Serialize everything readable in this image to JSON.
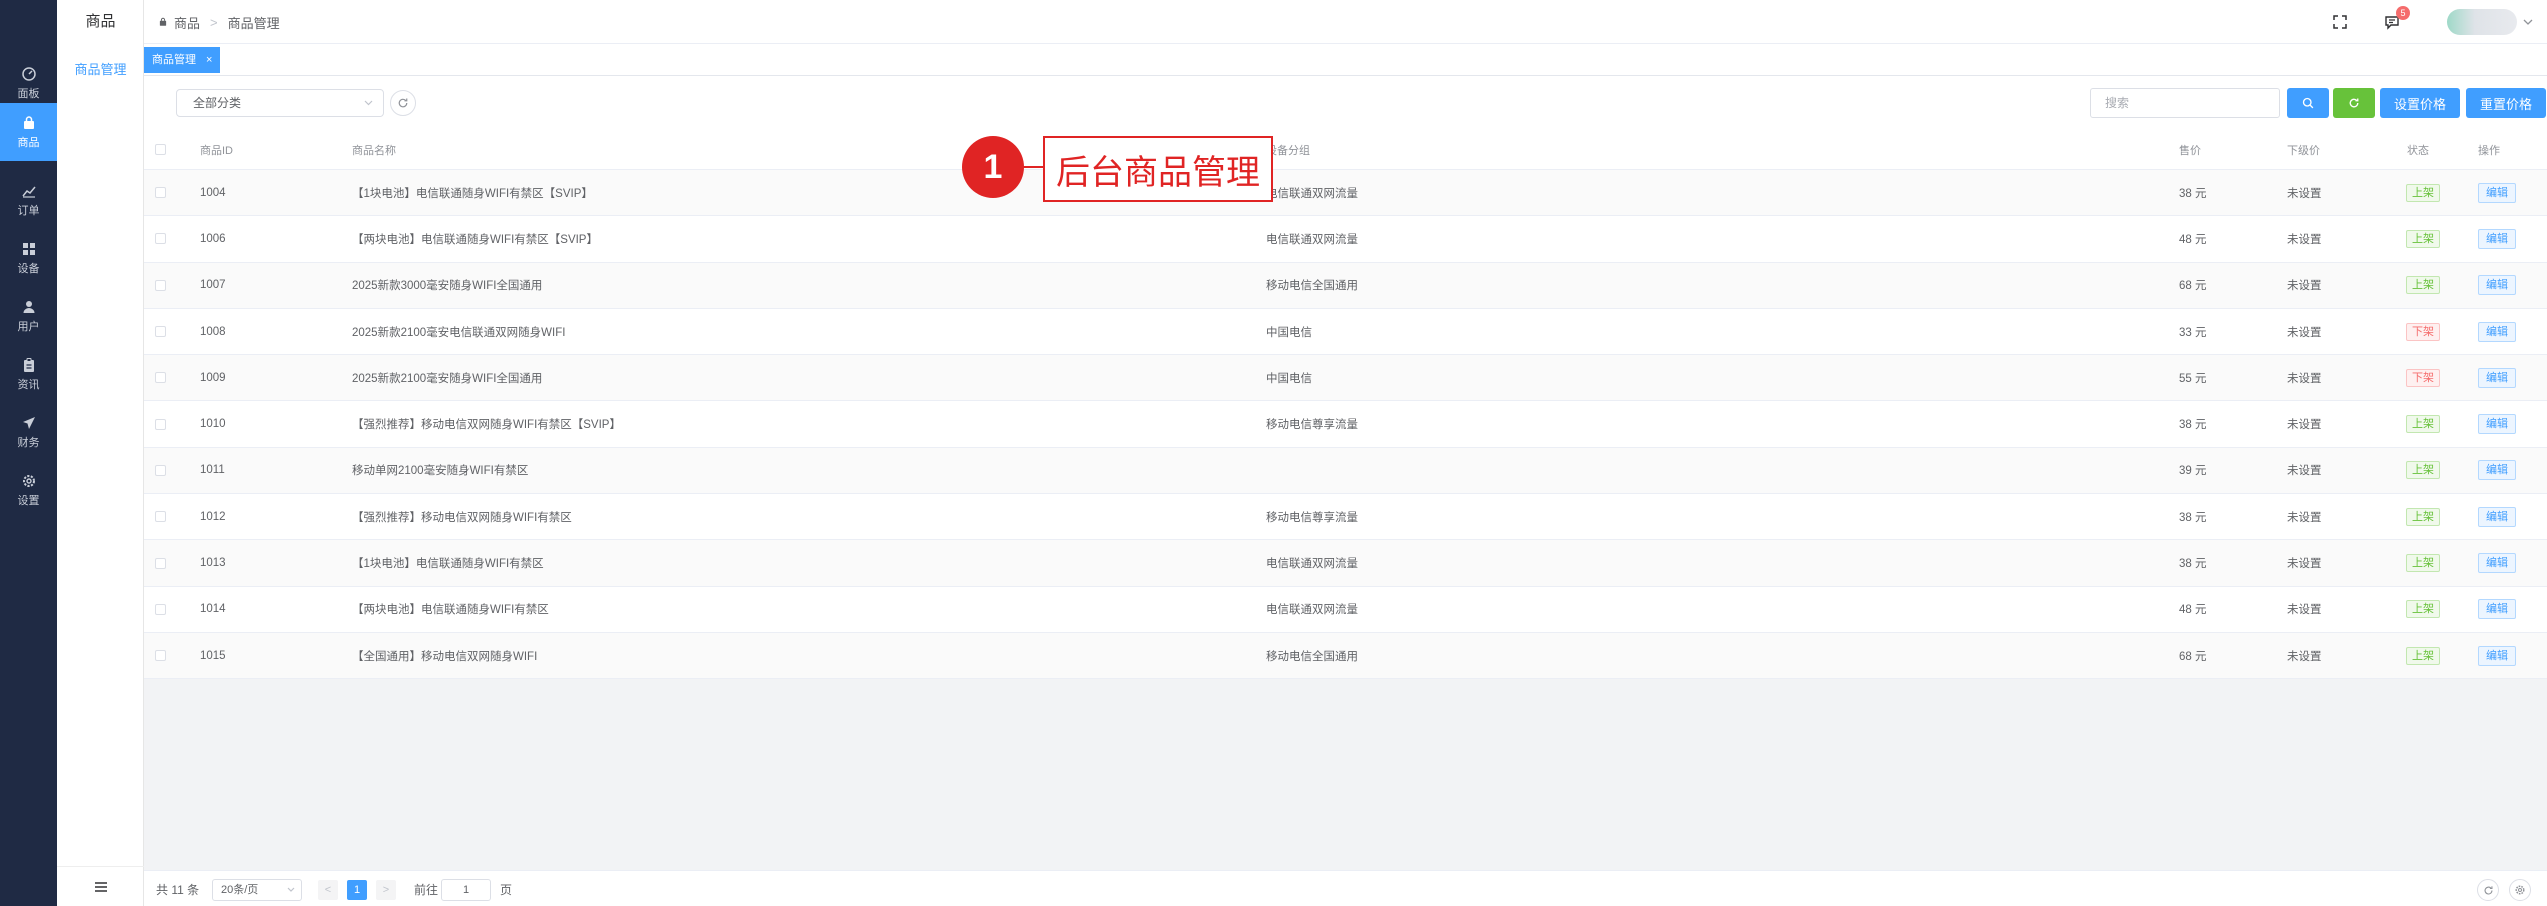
{
  "rail": [
    {
      "label": "面板",
      "icon": "gauge-icon"
    },
    {
      "label": "商品",
      "icon": "shopping-bag-icon",
      "active": true
    },
    {
      "label": "订单",
      "icon": "order-chart-icon"
    },
    {
      "label": "设备",
      "icon": "grid-icon"
    },
    {
      "label": "用户",
      "icon": "user-icon"
    },
    {
      "label": "资讯",
      "icon": "clipboard-icon"
    },
    {
      "label": "财务",
      "icon": "paper-plane-icon"
    },
    {
      "label": "设置",
      "icon": "gear-icon"
    }
  ],
  "submenu": {
    "title": "商品",
    "item": "商品管理",
    "bottom_icon": "hamburger-icon"
  },
  "breadcrumb": {
    "first": "商品",
    "separator": ">",
    "second": "商品管理"
  },
  "header": {
    "notifications": "5",
    "icons": [
      "fullscreen-icon",
      "message-icon",
      "avatar"
    ]
  },
  "tabs": [
    {
      "label": "商品管理",
      "close": "×"
    }
  ],
  "toolbar": {
    "category_select": "全部分类",
    "search_placeholder": "搜索",
    "set_price_label": "设置价格",
    "reset_price_label": "重置价格"
  },
  "annotation": {
    "number": "1",
    "text": "后台商品管理"
  },
  "table": {
    "headers": {
      "id": "商品ID",
      "name": "商品名称",
      "group": "设备分组",
      "price": "售价",
      "lower": "下级价",
      "status": "状态",
      "action": "操作"
    },
    "rows": [
      {
        "id": "1004",
        "name": "【1块电池】电信联通随身WIFI有禁区【SVIP】",
        "group": "电信联通双网流量",
        "price": "38 元",
        "lower": "未设置",
        "status": "上架",
        "on": true,
        "action": "编辑"
      },
      {
        "id": "1006",
        "name": "【两块电池】电信联通随身WIFI有禁区【SVIP】",
        "group": "电信联通双网流量",
        "price": "48 元",
        "lower": "未设置",
        "status": "上架",
        "on": true,
        "action": "编辑"
      },
      {
        "id": "1007",
        "name": "2025新款3000毫安随身WIFI全国通用",
        "group": "移动电信全国通用",
        "price": "68 元",
        "lower": "未设置",
        "status": "上架",
        "on": true,
        "action": "编辑"
      },
      {
        "id": "1008",
        "name": "2025新款2100毫安电信联通双网随身WIFI",
        "group": "中国电信",
        "price": "33 元",
        "lower": "未设置",
        "status": "下架",
        "on": false,
        "action": "编辑"
      },
      {
        "id": "1009",
        "name": "2025新款2100毫安随身WIFI全国通用",
        "group": "中国电信",
        "price": "55 元",
        "lower": "未设置",
        "status": "下架",
        "on": false,
        "action": "编辑"
      },
      {
        "id": "1010",
        "name": "【强烈推荐】移动电信双网随身WIFI有禁区【SVIP】",
        "group": "移动电信尊享流量",
        "price": "38 元",
        "lower": "未设置",
        "status": "上架",
        "on": true,
        "action": "编辑"
      },
      {
        "id": "1011",
        "name": "移动单网2100毫安随身WIFI有禁区",
        "group": "",
        "price": "39 元",
        "lower": "未设置",
        "status": "上架",
        "on": true,
        "action": "编辑"
      },
      {
        "id": "1012",
        "name": "【强烈推荐】移动电信双网随身WIFI有禁区",
        "group": "移动电信尊享流量",
        "price": "38 元",
        "lower": "未设置",
        "status": "上架",
        "on": true,
        "action": "编辑"
      },
      {
        "id": "1013",
        "name": "【1块电池】电信联通随身WIFI有禁区",
        "group": "电信联通双网流量",
        "price": "38 元",
        "lower": "未设置",
        "status": "上架",
        "on": true,
        "action": "编辑"
      },
      {
        "id": "1014",
        "name": "【两块电池】电信联通随身WIFI有禁区",
        "group": "电信联通双网流量",
        "price": "48 元",
        "lower": "未设置",
        "status": "上架",
        "on": true,
        "action": "编辑"
      },
      {
        "id": "1015",
        "name": "【全国通用】移动电信双网随身WIFI",
        "group": "移动电信全国通用",
        "price": "68 元",
        "lower": "未设置",
        "status": "上架",
        "on": true,
        "action": "编辑"
      }
    ]
  },
  "pagination": {
    "total": "共 11 条",
    "page_size": "20条/页",
    "current_page": "1",
    "prev": "<",
    "next": ">",
    "goto_label": "前往",
    "goto_value": "1",
    "page_suffix": "页"
  }
}
